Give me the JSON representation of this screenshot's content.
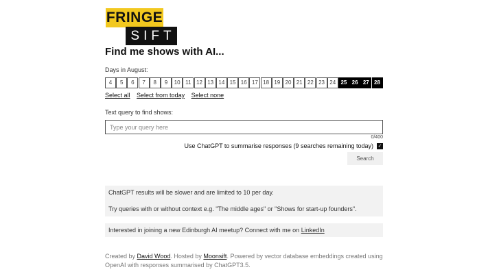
{
  "logo": {
    "top": "FRINGE",
    "bottom": "SIFT"
  },
  "title": "Find me shows with AI...",
  "days": {
    "label": "Days in August:",
    "items": [
      {
        "n": "4",
        "selected": false
      },
      {
        "n": "5",
        "selected": false
      },
      {
        "n": "6",
        "selected": false
      },
      {
        "n": "7",
        "selected": false
      },
      {
        "n": "8",
        "selected": false
      },
      {
        "n": "9",
        "selected": false
      },
      {
        "n": "10",
        "selected": false
      },
      {
        "n": "11",
        "selected": false
      },
      {
        "n": "12",
        "selected": false
      },
      {
        "n": "13",
        "selected": false
      },
      {
        "n": "14",
        "selected": false
      },
      {
        "n": "15",
        "selected": false
      },
      {
        "n": "16",
        "selected": false
      },
      {
        "n": "17",
        "selected": false
      },
      {
        "n": "18",
        "selected": false
      },
      {
        "n": "19",
        "selected": false
      },
      {
        "n": "20",
        "selected": false
      },
      {
        "n": "21",
        "selected": false
      },
      {
        "n": "22",
        "selected": false
      },
      {
        "n": "23",
        "selected": false
      },
      {
        "n": "24",
        "selected": false
      },
      {
        "n": "25",
        "selected": true
      },
      {
        "n": "26",
        "selected": true
      },
      {
        "n": "27",
        "selected": true
      },
      {
        "n": "28",
        "selected": true
      }
    ]
  },
  "links": {
    "select_all": "Select all",
    "select_from_today": "Select from today",
    "select_none": "Select none"
  },
  "query": {
    "label": "Text query to find shows:",
    "placeholder": "Type your query here",
    "value": "",
    "counter": "0/400"
  },
  "gpt": {
    "label": "Use ChatGPT to summarise responses (9 searches remaining today)",
    "checked": true,
    "check_glyph": "✓"
  },
  "search_label": "Search",
  "info": {
    "line1": "ChatGPT results will be slower and are limited to 10 per day.",
    "line2": "Try queries with or without context e.g. \"The middle ages\" or \"Shows for start-up founders\"."
  },
  "meetup": {
    "text": "Interested in joining a new Edinburgh AI meetup? Connect with me on ",
    "link": "LinkedIn"
  },
  "footer": {
    "created_by": "Created by ",
    "author": "David Wood",
    "hosted_by": ". Hosted by ",
    "host": "Moonsift",
    "powered": ". Powered by vector database embeddings created using OpenAI with responses summarised by ChatGPT3.5."
  }
}
